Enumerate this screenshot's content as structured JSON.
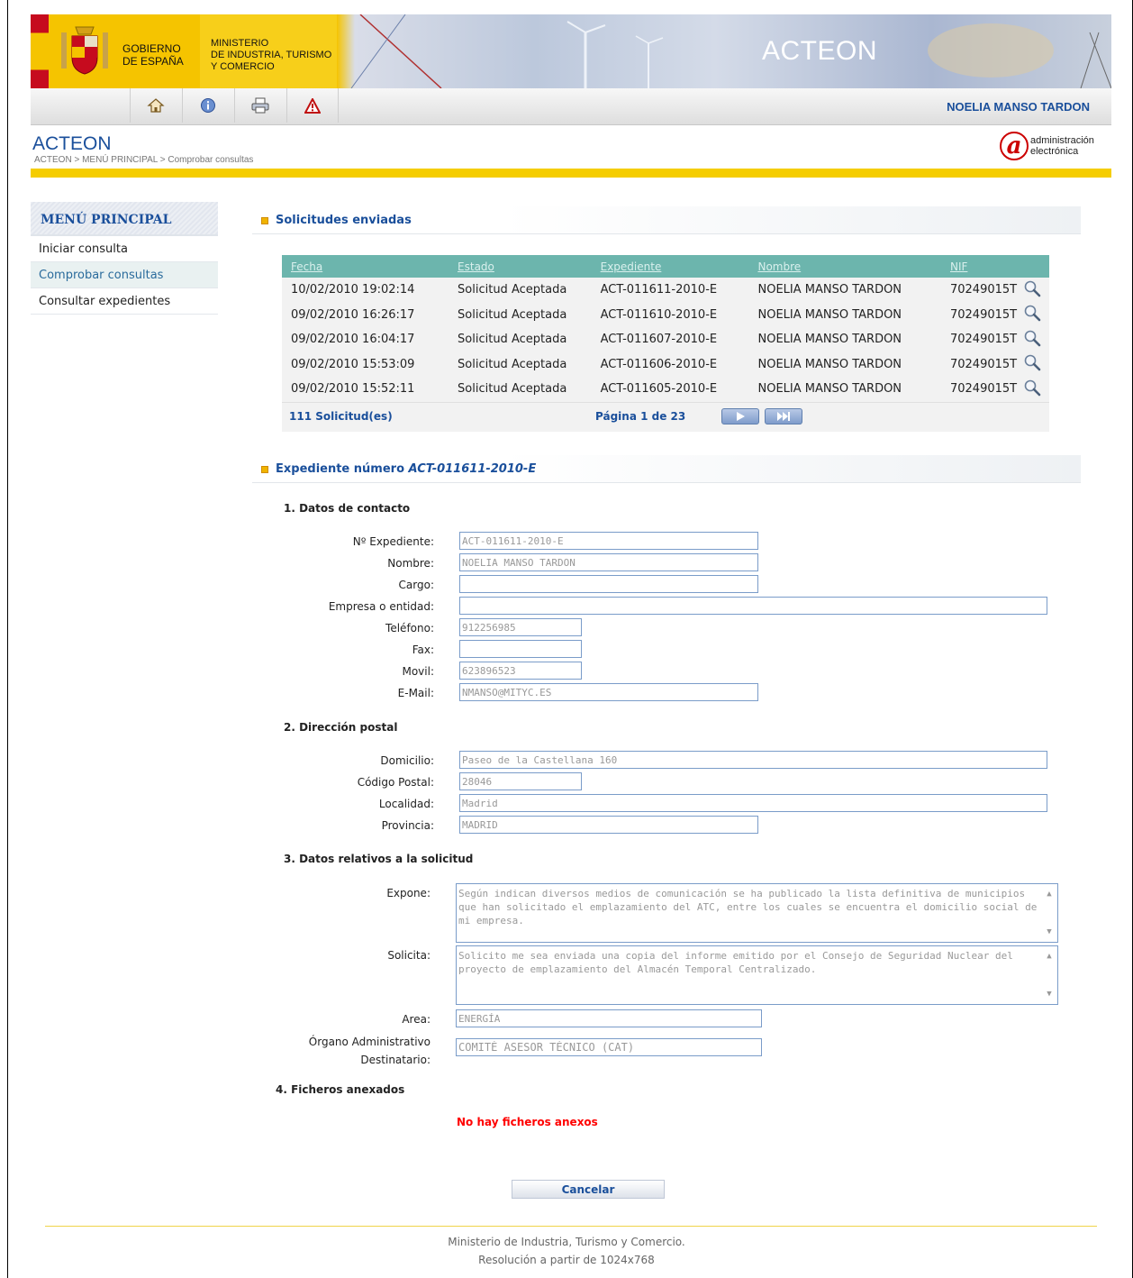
{
  "header": {
    "gobierno": "GOBIERNO\nDE ESPAÑA",
    "ministerio": "MINISTERIO\nDE INDUSTRIA, TURISMO\nY COMERCIO",
    "banner_title": "ACTEON",
    "user_name": "NOELIA MANSO TARDON",
    "toolbar_icons": [
      "home-icon",
      "info-icon",
      "print-icon",
      "warning-icon"
    ]
  },
  "app": {
    "title": "ACTEON",
    "breadcrumb": "ACTEON > MENÚ PRINCIPAL > Comprobar consultas",
    "admin_logo_line1": "administración",
    "admin_logo_line2": "electrónica"
  },
  "sidebar": {
    "title": "MENÚ PRINCIPAL",
    "items": [
      {
        "label": "Iniciar consulta",
        "active": false
      },
      {
        "label": "Comprobar consultas",
        "active": true
      },
      {
        "label": "Consultar expedientes",
        "active": false
      }
    ]
  },
  "solicitudes": {
    "heading": "Solicitudes enviadas",
    "columns": [
      "Fecha",
      "Estado",
      "Expediente",
      "Nombre",
      "NIF"
    ],
    "rows": [
      [
        "10/02/2010 19:02:14",
        "Solicitud Aceptada",
        "ACT-011611-2010-E",
        "NOELIA MANSO TARDON",
        "70249015T"
      ],
      [
        "09/02/2010 16:26:17",
        "Solicitud Aceptada",
        "ACT-011610-2010-E",
        "NOELIA MANSO TARDON",
        "70249015T"
      ],
      [
        "09/02/2010 16:04:17",
        "Solicitud Aceptada",
        "ACT-011607-2010-E",
        "NOELIA MANSO TARDON",
        "70249015T"
      ],
      [
        "09/02/2010 15:53:09",
        "Solicitud Aceptada",
        "ACT-011606-2010-E",
        "NOELIA MANSO TARDON",
        "70249015T"
      ],
      [
        "09/02/2010 15:52:11",
        "Solicitud Aceptada",
        "ACT-011605-2010-E",
        "NOELIA MANSO TARDON",
        "70249015T"
      ]
    ],
    "total": "111 Solicitud(es)",
    "pagination": "Página 1 de 23"
  },
  "expediente": {
    "heading_prefix": "Expediente número",
    "heading_number": "ACT-011611-2010-E",
    "section1": "1. Datos de contacto",
    "section2": "2. Dirección postal",
    "section3": "3. Datos relativos a la solicitud",
    "section4": "4. Ficheros anexados",
    "fields": {
      "num_expediente": {
        "label": "Nº Expediente:",
        "value": "ACT-011611-2010-E"
      },
      "nombre": {
        "label": "Nombre:",
        "value": "NOELIA MANSO TARDON"
      },
      "cargo": {
        "label": "Cargo:",
        "value": ""
      },
      "empresa": {
        "label": "Empresa o entidad:",
        "value": ""
      },
      "telefono": {
        "label": "Teléfono:",
        "value": "912256985"
      },
      "fax": {
        "label": "Fax:",
        "value": ""
      },
      "movil": {
        "label": "Movil:",
        "value": "623896523"
      },
      "email": {
        "label": "E-Mail:",
        "value": "NMANSO@MITYC.ES"
      },
      "domicilio": {
        "label": "Domicilio:",
        "value": "Paseo de la Castellana 160"
      },
      "codigo_postal": {
        "label": "Código Postal:",
        "value": "28046"
      },
      "localidad": {
        "label": "Localidad:",
        "value": "Madrid"
      },
      "provincia": {
        "label": "Provincia:",
        "value": "MADRID"
      },
      "expone": {
        "label": "Expone:",
        "value": "Según indican diversos medios de comunicación se ha publicado la lista definitiva de municipios que han solicitado el emplazamiento del ATC, entre los cuales se encuentra el domicilio social de mi empresa."
      },
      "solicita": {
        "label": "Solicita:",
        "value": "Solicito me sea enviada una copia del informe emitido por el Consejo de Seguridad Nuclear del proyecto de emplazamiento del Almacén Temporal Centralizado."
      },
      "area": {
        "label": "Area:",
        "value": "ENERGÍA"
      },
      "organo_line1": "Órgano Administrativo",
      "organo_line2": "Destinatario:",
      "organo_value": "COMITÉ ASESOR TÉCNICO (CAT)"
    },
    "no_attachments": "No hay ficheros anexos",
    "cancel_label": "Cancelar"
  },
  "footer": {
    "line1": "Ministerio de Industria, Turismo y Comercio.",
    "line2": "Resolución a partir de 1024x768"
  }
}
